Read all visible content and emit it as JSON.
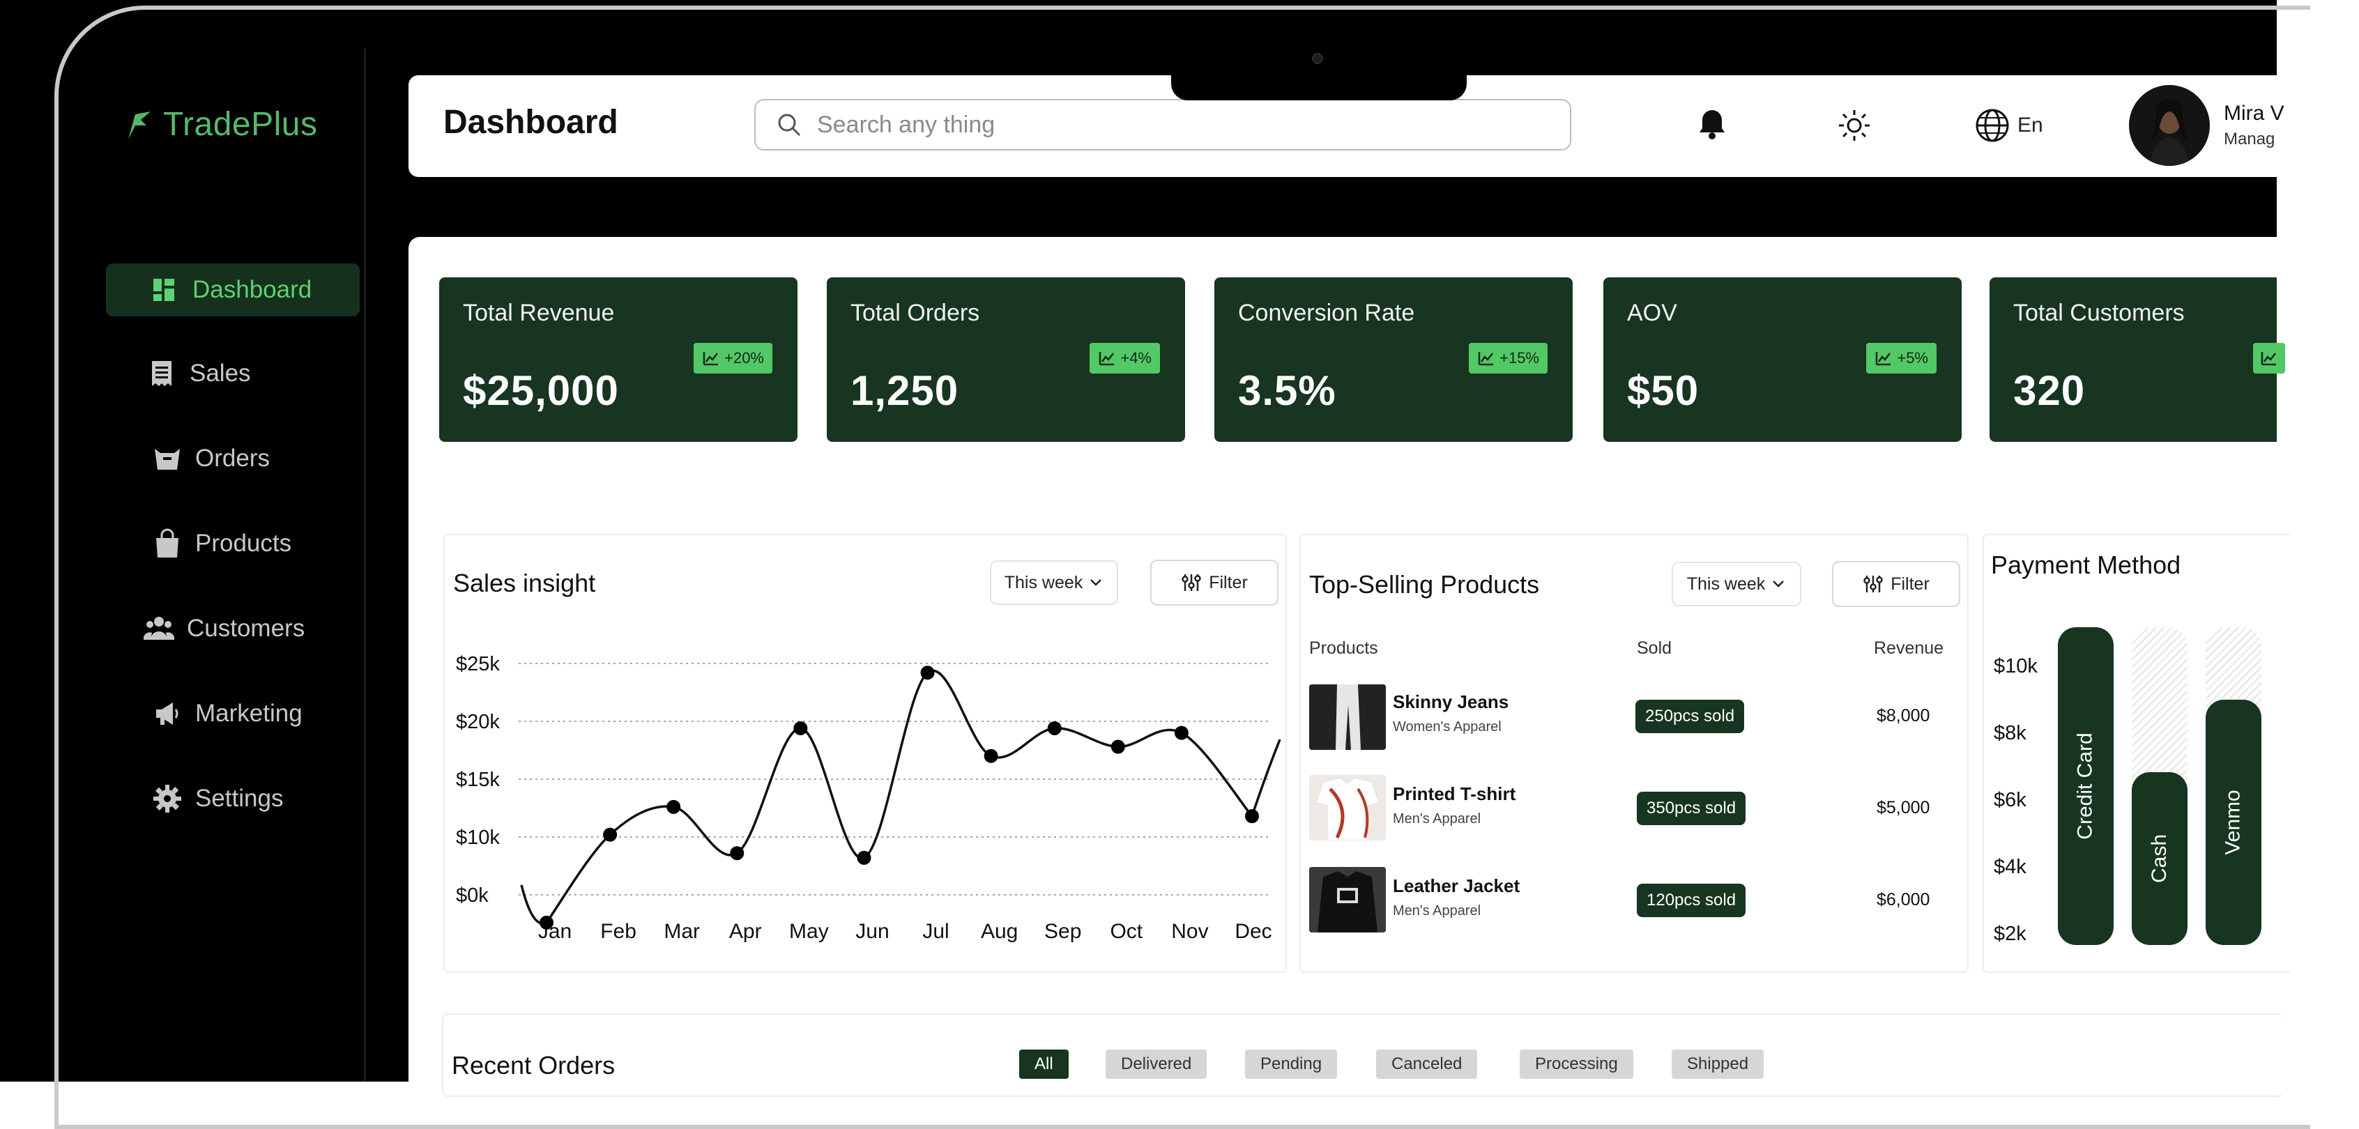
{
  "app": {
    "name": "TradePlus",
    "accent": "#58b86a",
    "dark_green": "#173520"
  },
  "sidebar": {
    "items": [
      {
        "label": "Dashboard",
        "icon": "dashboard-icon",
        "active": true
      },
      {
        "label": "Sales",
        "icon": "receipt-icon"
      },
      {
        "label": "Orders",
        "icon": "box-icon"
      },
      {
        "label": "Products",
        "icon": "bag-icon"
      },
      {
        "label": "Customers",
        "icon": "users-icon"
      },
      {
        "label": "Marketing",
        "icon": "megaphone-icon"
      },
      {
        "label": "Settings",
        "icon": "gear-icon"
      }
    ]
  },
  "header": {
    "title": "Dashboard",
    "search_placeholder": "Search any thing",
    "language": "En",
    "user_name": "Mira V",
    "user_role": "Manag"
  },
  "kpis": [
    {
      "label": "Total Revenue",
      "value": "$25,000",
      "change": "+20%"
    },
    {
      "label": "Total Orders",
      "value": "1,250",
      "change": "+4%"
    },
    {
      "label": "Conversion Rate",
      "value": "3.5%",
      "change": "+15%"
    },
    {
      "label": "AOV",
      "value": "$50",
      "change": "+5%"
    },
    {
      "label": "Total Customers",
      "value": "320",
      "change": ""
    }
  ],
  "sales_insight": {
    "title": "Sales insight",
    "period": "This week",
    "filter": "Filter"
  },
  "chart_data": {
    "type": "line",
    "title": "Sales insight",
    "x": [
      "Jan",
      "Feb",
      "Mar",
      "Apr",
      "May",
      "Jun",
      "Jul",
      "Aug",
      "Sep",
      "Oct",
      "Nov",
      "Dec"
    ],
    "y_ticks": [
      "$25k",
      "$20k",
      "$15k",
      "$10k",
      "$0k"
    ],
    "series": [
      {
        "values": [
          -3,
          6.5,
          9.5,
          4.5,
          18,
          4,
          24,
          15,
          18,
          16,
          17.5,
          8.5
        ]
      }
    ],
    "ylim": [
      -5,
      25
    ],
    "grid": "horizontal dotted"
  },
  "top_selling": {
    "title": "Top-Selling Products",
    "period": "This week",
    "filter": "Filter",
    "columns": [
      "Products",
      "Sold",
      "Revenue"
    ],
    "rows": [
      {
        "name": "Skinny Jeans",
        "category": "Women's Apparel",
        "sold": "250pcs sold",
        "revenue": "$8,000"
      },
      {
        "name": "Printed T-shirt",
        "category": "Men's Apparel",
        "sold": "350pcs sold",
        "revenue": "$5,000"
      },
      {
        "name": "Leather Jacket",
        "category": "Men's Apparel",
        "sold": "120pcs sold",
        "revenue": "$6,000"
      }
    ]
  },
  "payment_method": {
    "title": "Payment Method",
    "y_ticks": [
      "$10k",
      "$8k",
      "$6k",
      "$4k",
      "$2k"
    ],
    "bars": [
      {
        "label": "Credit Card",
        "value": 10
      },
      {
        "label": "Cash",
        "value": 6
      },
      {
        "label": "Venmo",
        "value": 8
      }
    ]
  },
  "recent_orders": {
    "title": "Recent Orders",
    "filters": [
      "All",
      "Delivered",
      "Pending",
      "Canceled",
      "Processing",
      "Shipped"
    ]
  }
}
